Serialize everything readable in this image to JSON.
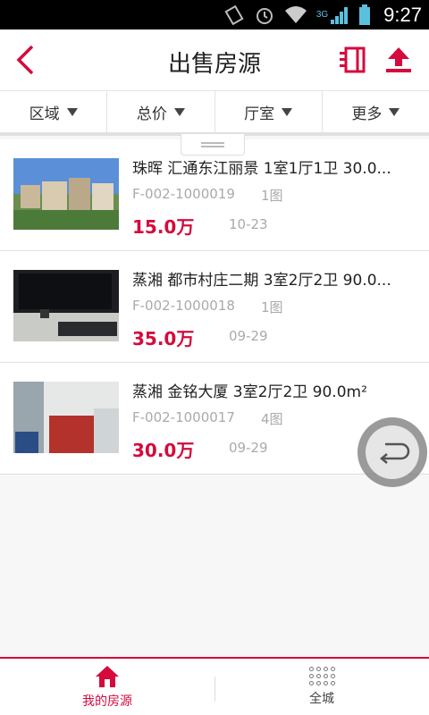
{
  "status_bar": {
    "time": "9:27",
    "network": "3G"
  },
  "header": {
    "title": "出售房源"
  },
  "filters": [
    {
      "label": "区域"
    },
    {
      "label": "总价"
    },
    {
      "label": "厅室"
    },
    {
      "label": "更多"
    }
  ],
  "listings": [
    {
      "title": "珠晖 汇通东江丽景 1室1厅1卫 30.0...",
      "code": "F-002-1000019",
      "pics": "1图",
      "price": "15.0万",
      "date": "10-23"
    },
    {
      "title": "蒸湘 都市村庄二期 3室2厅2卫 90.0...",
      "code": "F-002-1000018",
      "pics": "1图",
      "price": "35.0万",
      "date": "09-29"
    },
    {
      "title": "蒸湘 金铭大厦 3室2厅2卫 90.0m²",
      "code": "F-002-1000017",
      "pics": "4图",
      "price": "30.0万",
      "date": "09-29"
    }
  ],
  "bottom_nav": {
    "mine": "我的房源",
    "city": "全城"
  },
  "colors": {
    "accent": "#d40b3c"
  }
}
